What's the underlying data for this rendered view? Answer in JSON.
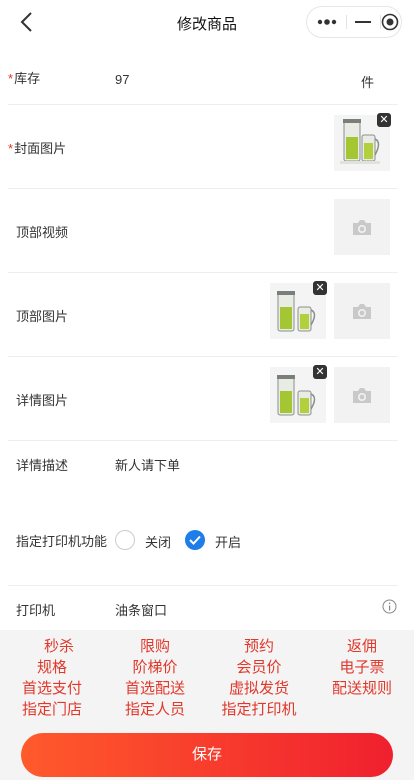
{
  "nav": {
    "title": "修改商品"
  },
  "form": {
    "stock": {
      "label": "库存",
      "value": "97",
      "unit": "件"
    },
    "cover": {
      "label": "封面图片"
    },
    "top_video": {
      "label": "顶部视频"
    },
    "top_images": {
      "label": "顶部图片"
    },
    "detail_images": {
      "label": "详情图片"
    },
    "description": {
      "label": "详情描述",
      "value": "新人请下单"
    },
    "printer_function": {
      "label": "指定打印机功能",
      "options": [
        {
          "label": "关闭",
          "selected": false
        },
        {
          "label": "开启",
          "selected": true
        }
      ]
    },
    "printer": {
      "label": "打印机",
      "value": "油条窗口"
    }
  },
  "menu": {
    "rows": [
      [
        "秒杀",
        "限购",
        "预约",
        "返佣"
      ],
      [
        "规格",
        "阶梯价",
        "会员价",
        "电子票"
      ],
      [
        "首选支付",
        "首选配送",
        "虚拟发货",
        "配送规则"
      ],
      [
        "指定门店",
        "指定人员",
        "指定打印机",
        ""
      ]
    ]
  },
  "save_label": "保存",
  "colors": {
    "accent_red": "#e0382b",
    "radio_blue": "#1e7de8",
    "button_start": "#ff5a2c",
    "button_end": "#f0202e"
  },
  "icons": [
    "back-chevron-icon",
    "more-dots-icon",
    "minimize-icon",
    "target-circle-icon",
    "camera-icon",
    "close-icon",
    "info-icon",
    "check-icon"
  ]
}
